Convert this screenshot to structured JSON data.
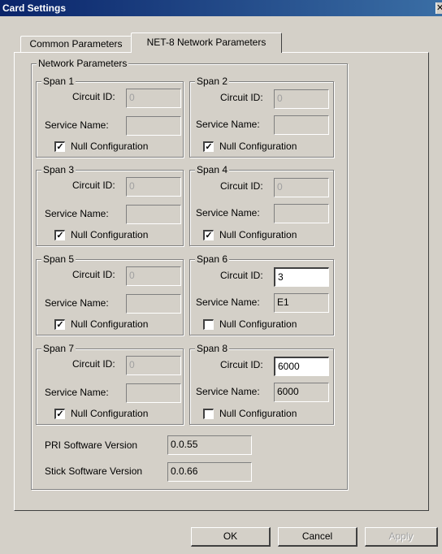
{
  "window": {
    "title": "Card Settings",
    "close_glyph": "✕"
  },
  "tabs": [
    {
      "label": "Common Parameters",
      "selected": false
    },
    {
      "label": "NET-8 Network Parameters",
      "selected": true
    }
  ],
  "network_group": {
    "label": "Network Parameters"
  },
  "labels": {
    "circuit_id": "Circuit ID:",
    "service_name": "Service Name:",
    "null_config": "Null Configuration"
  },
  "spans": [
    {
      "label": "Span 1",
      "circuit_id": "0",
      "service_name": "",
      "null_config": true
    },
    {
      "label": "Span 2",
      "circuit_id": "0",
      "service_name": "",
      "null_config": true
    },
    {
      "label": "Span 3",
      "circuit_id": "0",
      "service_name": "",
      "null_config": true
    },
    {
      "label": "Span 4",
      "circuit_id": "0",
      "service_name": "",
      "null_config": true
    },
    {
      "label": "Span 5",
      "circuit_id": "0",
      "service_name": "",
      "null_config": true
    },
    {
      "label": "Span 6",
      "circuit_id": "3",
      "service_name": "E1",
      "null_config": false
    },
    {
      "label": "Span 7",
      "circuit_id": "0",
      "service_name": "",
      "null_config": true
    },
    {
      "label": "Span 8",
      "circuit_id": "6000",
      "service_name": "6000",
      "null_config": false
    }
  ],
  "versions": {
    "pri_label": "PRI Software Version",
    "pri_value": "0.0.55",
    "stick_label": "Stick Software Version",
    "stick_value": "0.0.66"
  },
  "buttons": {
    "ok": "OK",
    "cancel": "Cancel",
    "apply": "Apply"
  },
  "check_glyph": "✓"
}
